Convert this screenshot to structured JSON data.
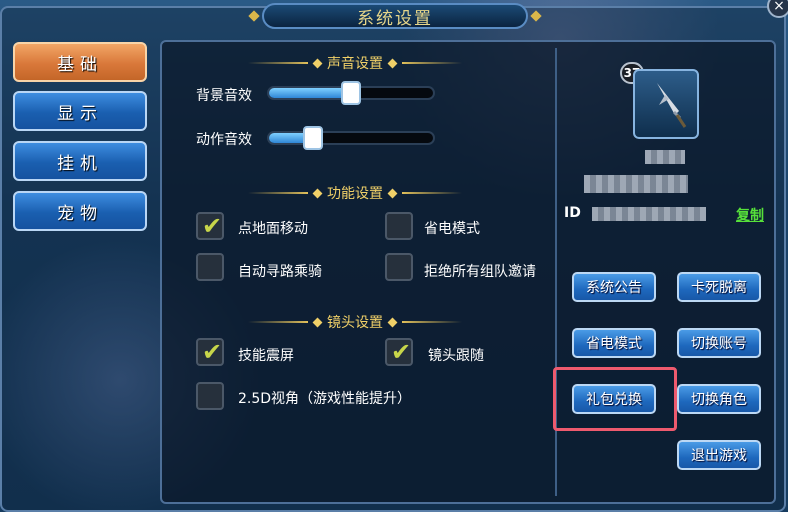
{
  "window": {
    "title": "系统设置",
    "close_glyph": "×"
  },
  "tabs": [
    {
      "label": "基础",
      "active": true
    },
    {
      "label": "显示",
      "active": false
    },
    {
      "label": "挂机",
      "active": false
    },
    {
      "label": "宠物",
      "active": false
    }
  ],
  "sound": {
    "header": "声音设置",
    "background_label": "背景音效",
    "background_level": 0.5,
    "action_label": "动作音效",
    "action_level": 0.27
  },
  "function": {
    "header": "功能设置",
    "options": [
      {
        "label": "点地面移动",
        "checked": true
      },
      {
        "label": "省电模式",
        "checked": false
      },
      {
        "label": "自动寻路乘骑",
        "checked": false
      },
      {
        "label": "拒绝所有组队邀请",
        "checked": false
      }
    ]
  },
  "camera": {
    "header": "镜头设置",
    "options": [
      {
        "label": "技能震屏",
        "checked": true
      },
      {
        "label": "镜头跟随",
        "checked": true
      },
      {
        "label": "2.5D视角（游戏性能提升）",
        "checked": false
      }
    ]
  },
  "profile": {
    "level": "37",
    "avatar_icon": "spear-icon",
    "id_label": "ID",
    "copy_label": "复制"
  },
  "actions": {
    "announcement": "系统公告",
    "unstuck": "卡死脱离",
    "power_saving": "省电模式",
    "switch_account": "切换账号",
    "gift_redeem": "礼包兑换",
    "switch_character": "切换角色",
    "exit_game": "退出游戏"
  },
  "colors": {
    "accent_gold": "#f0d068",
    "highlight": "#ee5a6e",
    "copy_green": "#56e03a",
    "active_tab": "#d9783a"
  }
}
